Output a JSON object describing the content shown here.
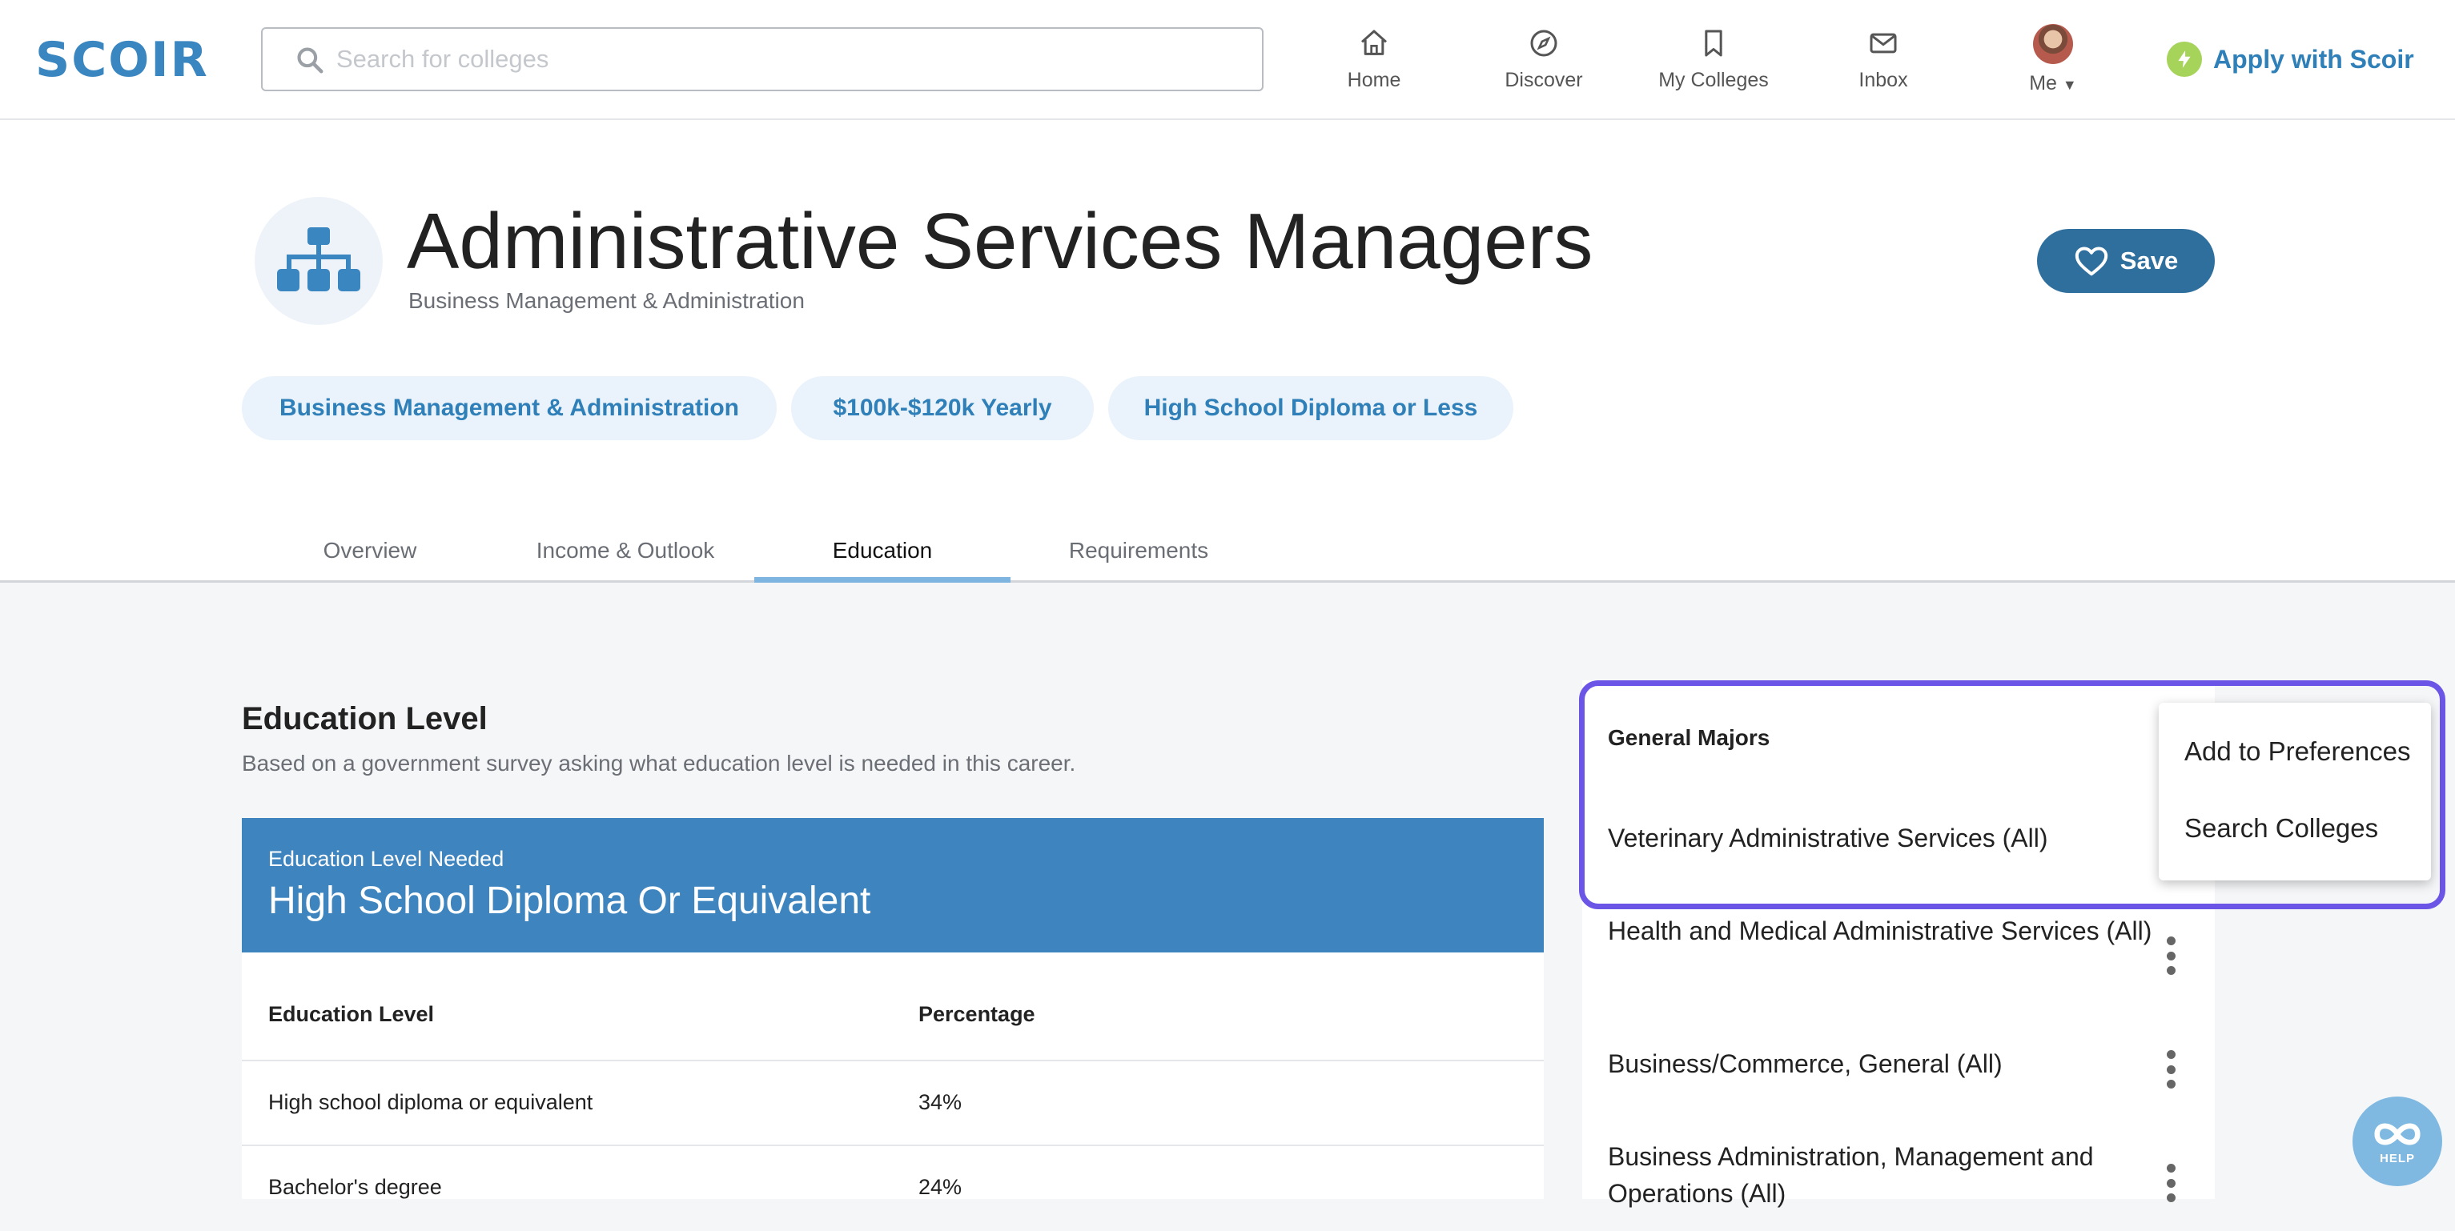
{
  "brand": {
    "logo_text": "SCOIR",
    "accent": "#3a86c0",
    "highlight": "#6a55e6"
  },
  "search": {
    "placeholder": "Search for colleges",
    "icon": "search-icon"
  },
  "nav": {
    "home": "Home",
    "discover": "Discover",
    "my_colleges": "My Colleges",
    "inbox": "Inbox",
    "me": "Me",
    "apply": "Apply with Scoir"
  },
  "career": {
    "title": "Administrative Services Managers",
    "subtitle": "Business Management & Administration",
    "save_label": "Save",
    "chips": [
      "Business Management & Administration",
      "$100k-$120k Yearly",
      "High School Diploma or Less"
    ]
  },
  "tabs": [
    {
      "label": "Overview",
      "active": false
    },
    {
      "label": "Income & Outlook",
      "active": false
    },
    {
      "label": "Education",
      "active": true
    },
    {
      "label": "Requirements",
      "active": false
    }
  ],
  "education": {
    "section_title": "Education Level",
    "section_sub": "Based on a government survey asking what education level is needed in this career.",
    "needed_caption": "Education Level Needed",
    "needed_value": "High School Diploma Or Equivalent",
    "table": {
      "headers": [
        "Education Level",
        "Percentage"
      ],
      "rows": [
        [
          "High school diploma or equivalent",
          "34%"
        ],
        [
          "Bachelor's degree",
          "24%"
        ]
      ]
    }
  },
  "majors": {
    "title": "General Majors",
    "items": [
      "Veterinary Administrative Services (All)",
      "Health and Medical Administrative Services (All)",
      "Business/Commerce, General (All)",
      "Business Administration, Management and Operations (All)"
    ]
  },
  "context_menu": {
    "add": "Add to Preferences",
    "search": "Search Colleges"
  },
  "help": {
    "label": "HELP"
  }
}
